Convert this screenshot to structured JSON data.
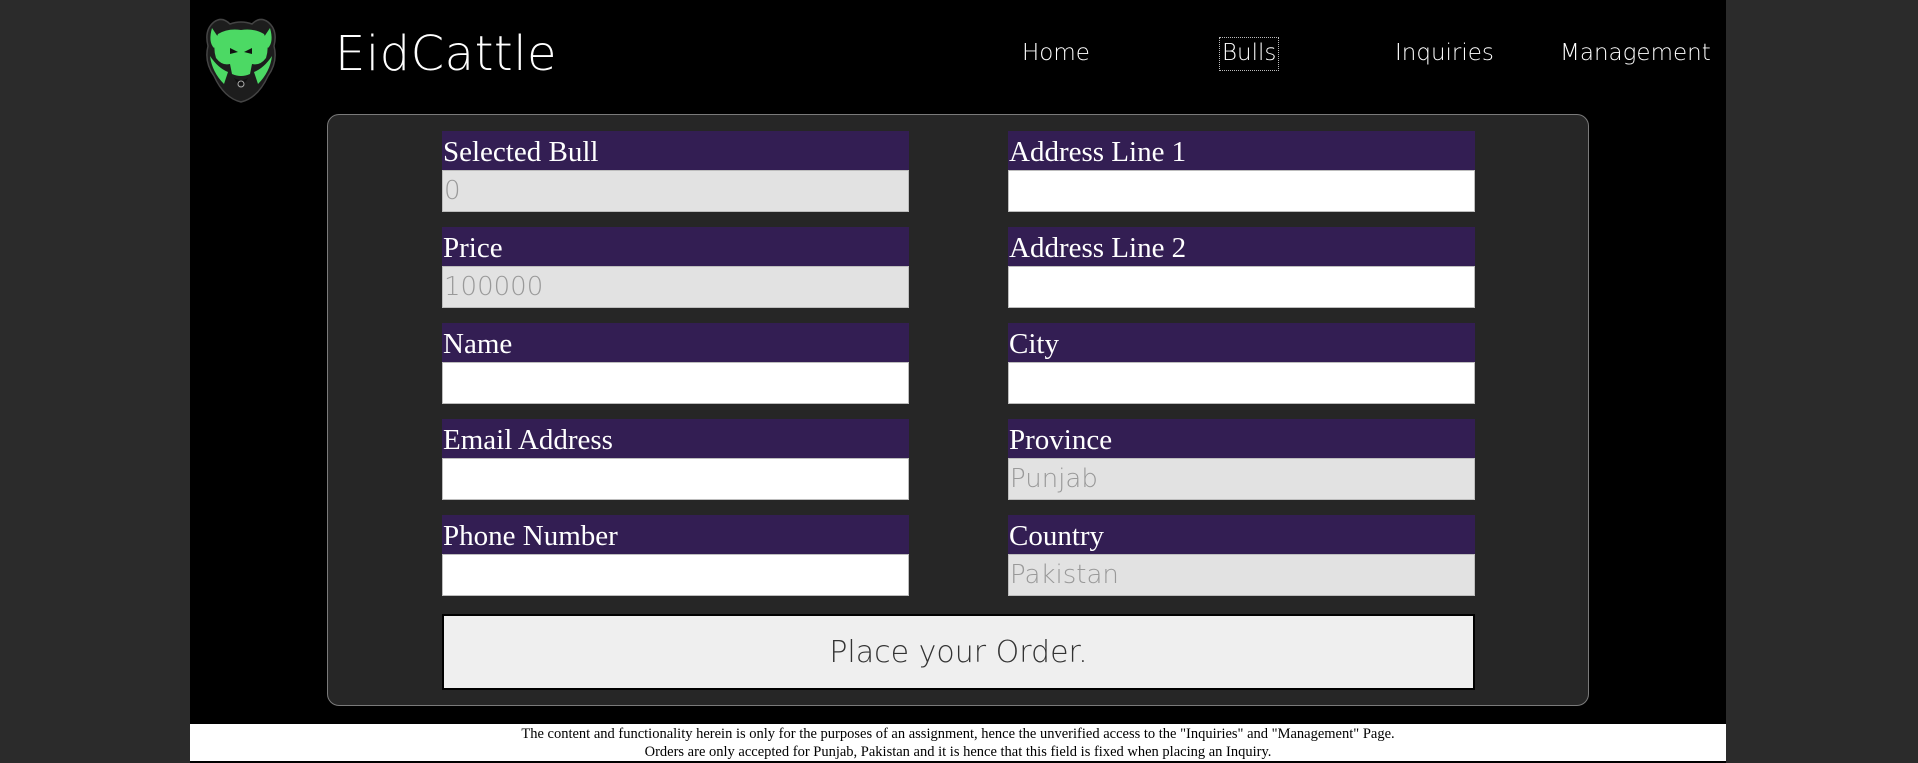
{
  "brand": {
    "name": "EidCattle",
    "logo_icon": "bull-head-icon"
  },
  "nav": [
    {
      "label": "Home",
      "active": false
    },
    {
      "label": "Bulls",
      "active": true
    },
    {
      "label": "Inquiries",
      "active": false
    },
    {
      "label": "Management",
      "active": false
    }
  ],
  "form": {
    "left": [
      {
        "label": "Selected Bull",
        "value": "0",
        "readonly": true
      },
      {
        "label": "Price",
        "value": "100000",
        "readonly": true
      },
      {
        "label": "Name",
        "value": "",
        "readonly": false
      },
      {
        "label": "Email Address",
        "value": "",
        "readonly": false
      },
      {
        "label": "Phone Number",
        "value": "",
        "readonly": false
      }
    ],
    "right": [
      {
        "label": "Address Line 1",
        "value": "",
        "readonly": false
      },
      {
        "label": "Address Line 2",
        "value": "",
        "readonly": false
      },
      {
        "label": "City",
        "value": "",
        "readonly": false
      },
      {
        "label": "Province",
        "value": "Punjab",
        "readonly": true
      },
      {
        "label": "Country",
        "value": "Pakistan",
        "readonly": true
      }
    ],
    "submit_label": "Place your Order."
  },
  "footer": {
    "line1": "The content and functionality herein is only for the purposes of an assignment, hence the unverified access to the \"Inquiries\" and \"Management\" Page.",
    "line2": "Orders are only accepted for Punjab, Pakistan and it is hence that this field is fixed when placing an Inquiry."
  },
  "colors": {
    "page_bg": "#000000",
    "outer_bg": "#2b2b2b",
    "panel_bg": "#262626",
    "label_bg": "#331e53",
    "logo_green": "#4cd964",
    "readonly_bg": "#e2e2e2"
  }
}
